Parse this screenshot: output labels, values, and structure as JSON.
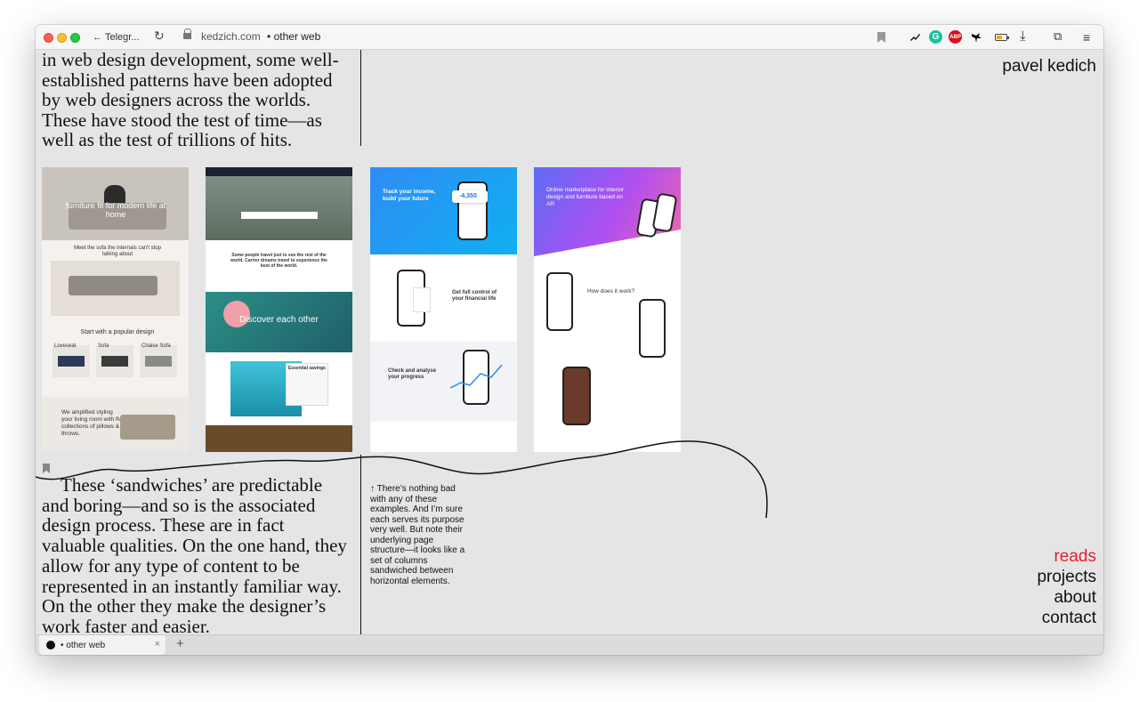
{
  "toolbar": {
    "back_label": "Telegr...",
    "url_host": "kedzich.com",
    "url_title": "• other web"
  },
  "page": {
    "author": "pavel kedich",
    "para1": "in web design development, some well-established patterns have been adopted by web designers across the worlds. These have stood the test of time—as well as the test of trillions of hits.",
    "para2": "These ‘sandwiches’ are predictable and boring—and so is the associated design process. These are in fact valuable qualities. On the one hand, they allow for any type of content to be represented in an instantly familiar way. On the other they make the designer’s work faster and easier.",
    "note": "↑ There’s nothing bad with any of these examples. And I’m sure each serves its purpose very well. But note their underlying page structure—it looks like a set of columns sandwiched between horizontal elements."
  },
  "shots": {
    "s1": {
      "hero": "furniture fit for modern life at home",
      "mid": "Meet the sofa the internals can't stop talking about",
      "section": "Start with a popular design",
      "items": [
        "Loveseat",
        "Sofa",
        "Chaise Sofa"
      ],
      "footer": "We amplified styling your living room with five collections of pillows & throws."
    },
    "s2": {
      "tagline": "Some people travel just to see the rest of the world. Carrier dreams travel to experience the best of the world.",
      "hero2": "Discover each other",
      "card": "Essential savings"
    },
    "s3": {
      "hero": "Track your income, build your future",
      "amount": "-4,350",
      "f1": "Get full control of your financial life",
      "f2": "Check and analyse your progress"
    },
    "s4": {
      "hero": "Online marketplace for interior design and furniture based on AR",
      "how": "How does it work?"
    }
  },
  "nav": {
    "reads": "reads",
    "projects": "projects",
    "about": "about",
    "contact": "contact"
  },
  "tab": {
    "title": "• other web",
    "close": "×",
    "new": "+"
  },
  "colors": {
    "accent": "#e3202c",
    "background": "#e5e5e5"
  }
}
